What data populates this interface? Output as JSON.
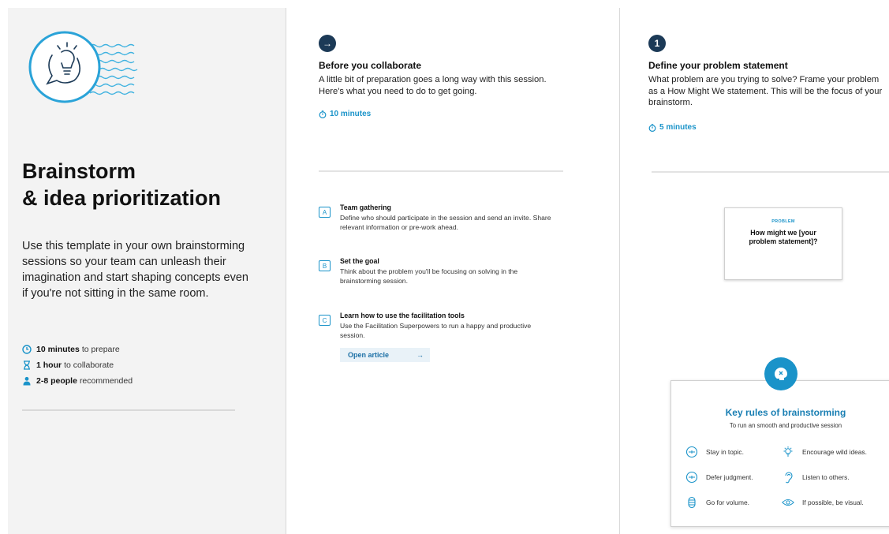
{
  "intro": {
    "title_line1": "Brainstorm",
    "title_line2": "& idea prioritization",
    "description": "Use this template in your own brainstorming sessions so your team can unleash their imagination and start shaping concepts even if you're not sitting in the same room.",
    "facts": [
      {
        "icon": "clock-icon",
        "bold": "10 minutes",
        "text": "to prepare"
      },
      {
        "icon": "hourglass-icon",
        "bold": "1 hour",
        "text": "to collaborate"
      },
      {
        "icon": "person-icon",
        "bold": "2-8 people",
        "text": "recommended"
      }
    ]
  },
  "before": {
    "badge": "→",
    "title": "Before you collaborate",
    "body": "A little bit of preparation goes a long way with this session. Here's what you need to do to get going.",
    "timer": "10 minutes",
    "items": [
      {
        "letter": "A",
        "title": "Team gathering",
        "body": "Define who should participate in the session and send an invite. Share relevant information or pre-work ahead."
      },
      {
        "letter": "B",
        "title": "Set the goal",
        "body": "Think about the problem you'll be focusing on solving in the brainstorming session."
      },
      {
        "letter": "C",
        "title": "Learn how to use the facilitation tools",
        "body": "Use the Facilitation Superpowers to run a happy and productive session."
      }
    ],
    "open_article": "Open article",
    "open_arrow": "→"
  },
  "define": {
    "badge": "1",
    "title": "Define your problem statement",
    "body": "What problem are you trying to solve? Frame your problem as a How Might We statement. This will be the focus of your brainstorm.",
    "timer": "5 minutes",
    "problem_label": "PROBLEM",
    "problem_text": "How might we [your problem statement]?"
  },
  "rules": {
    "title": "Key rules of brainstorming",
    "subtitle": "To run an smooth and productive session",
    "items": [
      {
        "icon": "target-icon",
        "label": "Stay in topic."
      },
      {
        "icon": "lightbulb-icon",
        "label": "Encourage wild ideas."
      },
      {
        "icon": "target-icon",
        "label": "Defer judgment."
      },
      {
        "icon": "ear-icon",
        "label": "Listen to others."
      },
      {
        "icon": "stack-icon",
        "label": "Go for volume."
      },
      {
        "icon": "eye-icon",
        "label": "If possible, be visual."
      }
    ]
  },
  "colors": {
    "accent": "#1a93c9",
    "navy": "#1c3a57",
    "panel_bg": "#f3f3f3"
  }
}
